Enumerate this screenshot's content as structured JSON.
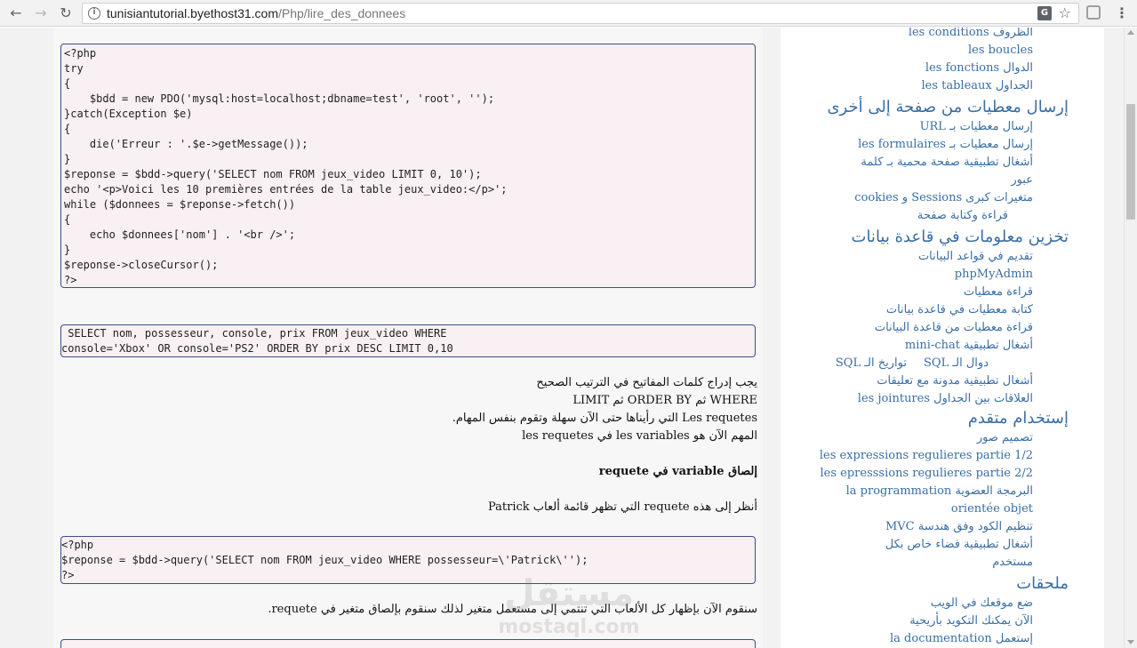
{
  "browser": {
    "url_host": "tunisiantutorial.byethost31.com",
    "url_path": "/Php/lire_des_donnees"
  },
  "content": {
    "code1": [
      "<?php",
      "try",
      "{",
      "    $bdd = new PDO('mysql:host=localhost;dbname=test', 'root', '');",
      "}catch(Exception $e)",
      "{",
      "    die('Erreur : '.$e->getMessage());",
      "}",
      "$reponse = $bdd->query('SELECT nom FROM jeux_video LIMIT 0, 10');",
      "echo '<p>Voici les 10 premières entrées de la table jeux_video:</p>';",
      "while ($donnees = $reponse->fetch())",
      "{",
      "    echo $donnees['nom'] . '<br />';",
      "}",
      "$reponse->closeCursor();",
      "?>"
    ],
    "code2": [
      " SELECT nom, possesseur, console, prix FROM jeux_video WHERE",
      "console='Xbox' OR console='PS2' ORDER BY prix DESC LIMIT 0,10"
    ],
    "para1": [
      "يجب إدراج كلمات المفاتيح في الترتيب الصحيح",
      "WHERE ثم ORDER BY ثم LIMIT",
      "Les requetes التي رأيناها حتى الآن سهلة وتقوم بنفس المهام.",
      "المهم الآن هو les variables في les requetes"
    ],
    "heading": "إلصاق variable في requete",
    "para2": "أنظر إلى هذه requete التي تظهر قائمة ألعاب Patrick",
    "code3": [
      "<?php",
      "$reponse = $bdd->query('SELECT nom FROM jeux_video WHERE possesseur=\\'Patrick\\'');",
      "?>"
    ],
    "para3": "سنقوم الآن بإظهار كل الألعاب التي تنتمي إلى مستعمل متغير لذلك سنقوم بإلصاق متغير في requete."
  },
  "sidebar": {
    "items": [
      {
        "type": "link",
        "label": "الظروف les conditions"
      },
      {
        "type": "link",
        "label": "les boucles"
      },
      {
        "type": "link",
        "label": "الدوال les fonctions"
      },
      {
        "type": "link",
        "label": "الجداول les tableaux"
      },
      {
        "type": "head",
        "label": "إرسال معطيات من صفحة إلى أخرى"
      },
      {
        "type": "link",
        "label": "إرسال معطيات بـ URL"
      },
      {
        "type": "link",
        "label": "إرسال معطيات بـ les formulaires"
      },
      {
        "type": "link",
        "label": "أشغال تطبيقية صفحة محمية بـ كلمة"
      },
      {
        "type": "link",
        "label": "عبور"
      },
      {
        "type": "link",
        "label": "متغيرات كبرى Sessions و cookies"
      },
      {
        "type": "link",
        "label": "قراءة وكتابة صفحة"
      },
      {
        "type": "head",
        "label": "تخزين معلومات في قاعدة بيانات"
      },
      {
        "type": "link",
        "label": "تقديم في قواعد البيانات"
      },
      {
        "type": "link",
        "label": "phpMyAdmin"
      },
      {
        "type": "link",
        "label": "قراءة معطيات"
      },
      {
        "type": "link",
        "label": "كتابة معطيات في قاعدة بيانات"
      },
      {
        "type": "link",
        "label": "قراءة معطيات من قاعدة البيانات"
      },
      {
        "type": "link",
        "label": "أشغال تطبيقية mini-chat"
      },
      {
        "type": "split",
        "label": "دوال الـ SQL",
        "label2": "تواريخ الـ SQL"
      },
      {
        "type": "link",
        "label": "أشغال تطبيقية مدونة مع تعليقات"
      },
      {
        "type": "link",
        "label": "العلاقات بين الجداول les jointures"
      },
      {
        "type": "head",
        "label": "إستخدام متقدم"
      },
      {
        "type": "link",
        "label": "تصميم صور"
      },
      {
        "type": "link",
        "label": "les expressions regulieres partie 1/2"
      },
      {
        "type": "link",
        "label": "les epresssions regulieres partie 2/2"
      },
      {
        "type": "link",
        "label": "البرمجة العضوية la programmation"
      },
      {
        "type": "link",
        "label": "orientée objet"
      },
      {
        "type": "link",
        "label": "تنظيم الكود وفق هندسة MVC"
      },
      {
        "type": "link",
        "label": "أشغال تطبيقية فضاء خاص بكل"
      },
      {
        "type": "link",
        "label": "مستخدم"
      },
      {
        "type": "head",
        "label": "ملحقات"
      },
      {
        "type": "link",
        "label": "ضع موقعك في الويب"
      },
      {
        "type": "link",
        "label": "الآن يمكنك التكويد بأريحية"
      },
      {
        "type": "link",
        "label": "إستعمل la documentation"
      }
    ]
  },
  "watermark": {
    "arabic": "مستقل",
    "latin": "mostaql.com"
  },
  "colors": {
    "link": "#3a6ea5",
    "code_bg": "#f8f0f3",
    "code_border": "#3b4f86"
  }
}
